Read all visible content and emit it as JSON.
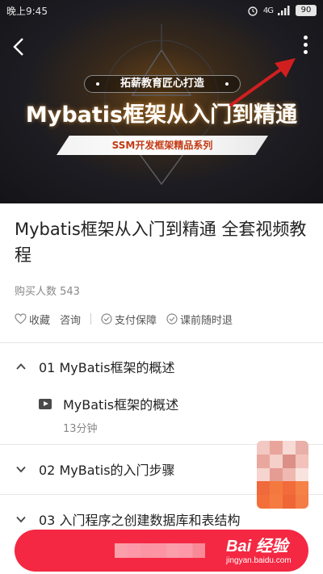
{
  "status_bar": {
    "time": "晚上9:45",
    "network": "4G",
    "battery": "90"
  },
  "hero": {
    "brand": "拓薪教育匠心打造",
    "title": "Mybatis框架从入门到精通",
    "ribbon": "SSM开发框架精品系列"
  },
  "course": {
    "title": "Mybatis框架从入门到精通 全套视频教程",
    "buyers": "购买人数 543"
  },
  "services": [
    {
      "label": "收藏",
      "icon": "heart-icon"
    },
    {
      "label": "咨询",
      "icon": "none"
    },
    {
      "label": "支付保障",
      "icon": "check-circle-icon"
    },
    {
      "label": "课前随时退",
      "icon": "check-circle-icon"
    }
  ],
  "chapters": [
    {
      "label": "01 MyBatis框架的概述",
      "state": "expanded"
    },
    {
      "label": "02 MyBatis的入门步骤",
      "state": "collapsed"
    },
    {
      "label": "03 入门程序之创建数据库和表结构",
      "state": "collapsed"
    }
  ],
  "lesson": {
    "name": "MyBatis框架的概述",
    "duration": "13分钟"
  },
  "watermark": {
    "main": "Bai 经验",
    "sub": "jingyan.baidu.com"
  },
  "colors": {
    "accent": "#f42842",
    "annotation_arrow": "#d11f1f",
    "muted_text": "#888888"
  }
}
